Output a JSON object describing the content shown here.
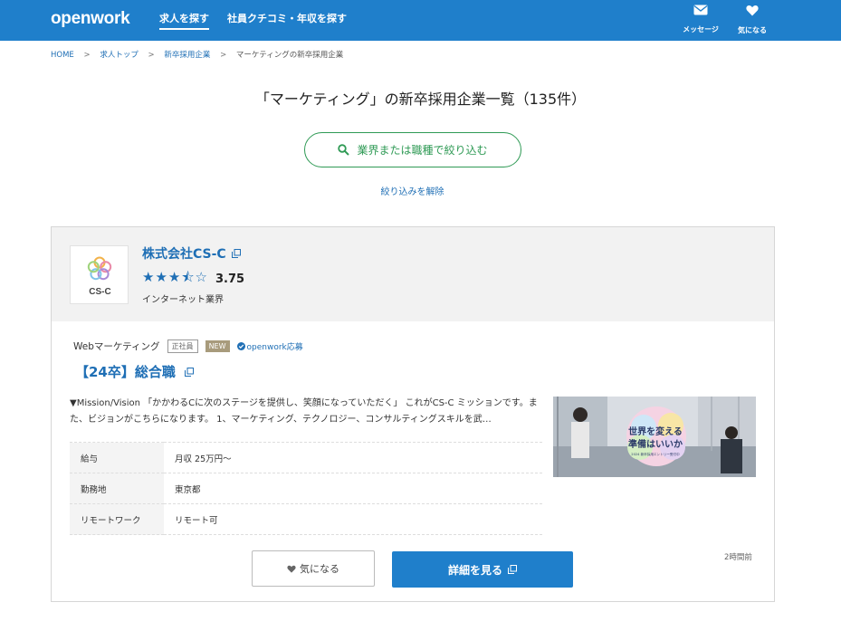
{
  "header": {
    "logo": "openwork",
    "nav": [
      "求人を探す",
      "社員クチコミ・年収を探す"
    ],
    "messages_label": "メッセージ",
    "favorites_label": "気になる"
  },
  "breadcrumb": {
    "items": [
      "HOME",
      "求人トップ",
      "新卒採用企業"
    ],
    "current": "マーケティングの新卒採用企業",
    "separator": ">"
  },
  "page": {
    "title": "「マーケティング」の新卒採用企業一覧（135件）",
    "filter_button": "業界または職種で絞り込む",
    "clear_filter": "絞り込みを解除"
  },
  "card": {
    "company_name": "株式会社CS-C",
    "logo_text": "CS-C",
    "stars": "★★★⯪☆",
    "rating": "3.75",
    "industry": "インターネット業界",
    "job_category": "Webマーケティング",
    "tag_employment": "正社員",
    "tag_new": "NEW",
    "openwork_apply": "openwork応募",
    "job_title": "【24卒】総合職",
    "description": "▼Mission/Vision 「かかわるCに次のステージを提供し、笑顔になっていただく」 これがCS-C ミッションです。また、ビジョンがこちらになります。 1、マーケティング、テクノロジー、コンサルティングスキルを武…",
    "image_text_line1": "世界を変える",
    "image_text_line2": "準備はいいか",
    "image_text_small": "2024 新卒採用エントリー受付中",
    "info": [
      {
        "label": "給与",
        "value": "月収 25万円〜"
      },
      {
        "label": "勤務地",
        "value": "東京都"
      },
      {
        "label": "リモートワーク",
        "value": "リモート可"
      }
    ],
    "like_button": "気になる",
    "detail_button": "詳細を見る",
    "posted": "2時間前"
  },
  "colors": {
    "header_blue": "#1f7fcb",
    "link_blue": "#1f6fb5",
    "filter_green": "#2f9a55",
    "new_tag": "#a89b7c"
  }
}
